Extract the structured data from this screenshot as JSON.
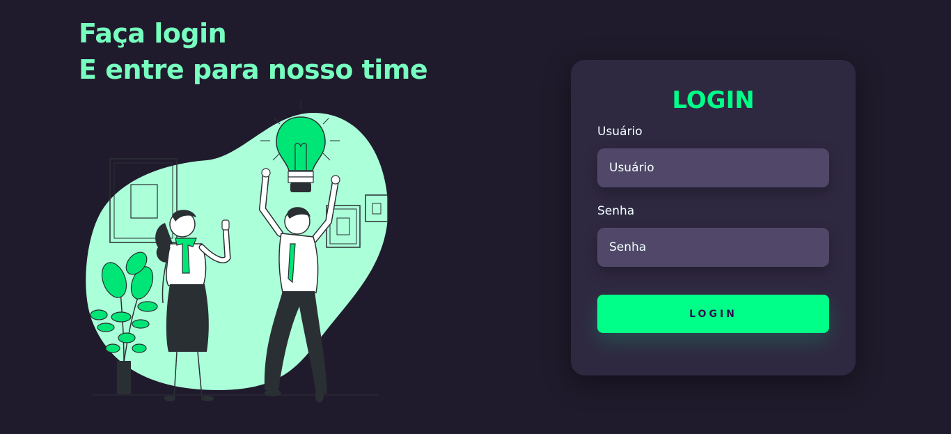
{
  "hero": {
    "line1": "Faça login",
    "line2": "E entre para nosso time",
    "illustration_icon": "team-celebration-illustration"
  },
  "login_card": {
    "title": "LOGIN",
    "username": {
      "label": "Usuário",
      "placeholder": "Usuário",
      "value": ""
    },
    "password": {
      "label": "Senha",
      "placeholder": "Senha",
      "value": ""
    },
    "submit_label": "LOGIN"
  },
  "colors": {
    "background": "#201b2c",
    "card": "#2f2841",
    "input": "#514869",
    "accent": "#00ff88",
    "headline": "#77ffc0",
    "blob": "#abffd9"
  }
}
